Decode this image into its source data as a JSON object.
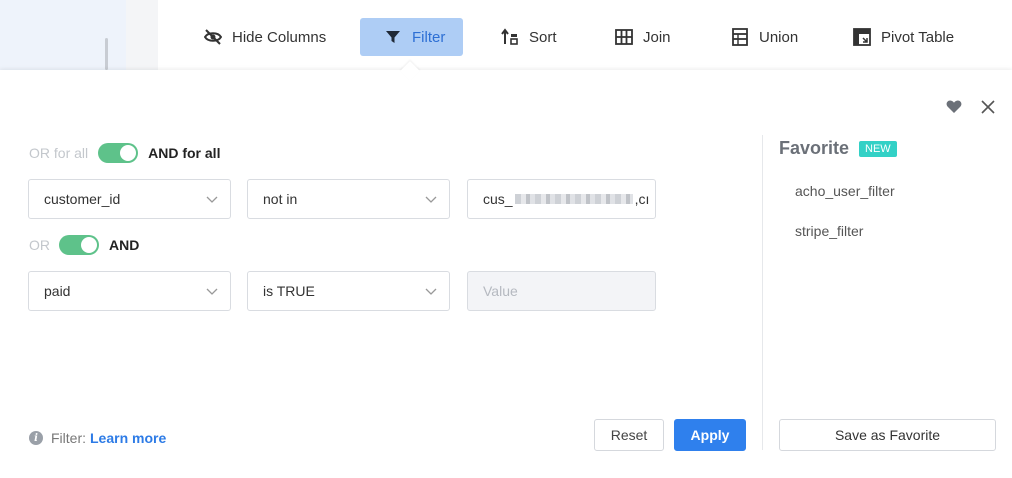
{
  "toolbar": {
    "items": [
      {
        "label": "Hide Columns",
        "icon": "eye-off-icon",
        "active": false
      },
      {
        "label": "Filter",
        "icon": "filter-icon",
        "active": true
      },
      {
        "label": "Sort",
        "icon": "sort-icon",
        "active": false
      },
      {
        "label": "Join",
        "icon": "join-icon",
        "active": false
      },
      {
        "label": "Union",
        "icon": "union-icon",
        "active": false
      },
      {
        "label": "Pivot Table",
        "icon": "pivot-table-icon",
        "active": false
      }
    ]
  },
  "panel": {
    "icons": {
      "favorite": "heart-icon",
      "close": "close-icon"
    },
    "group_logic": {
      "left": "OR for all",
      "right": "AND for all",
      "selected": "AND for all"
    },
    "conditions": [
      {
        "column": "customer_id",
        "operator": "not in",
        "value_prefix": "cus_",
        "value_suffix": ",cı",
        "value_placeholder": ""
      },
      {
        "column": "paid",
        "operator": "is TRUE",
        "value_prefix": "",
        "value_suffix": "",
        "value_placeholder": "Value"
      }
    ],
    "condition_logic": {
      "left": "OR",
      "right": "AND",
      "selected": "AND"
    },
    "help": {
      "prefix": "Filter:",
      "link": "Learn more"
    },
    "buttons": {
      "reset": "Reset",
      "apply": "Apply"
    }
  },
  "favorites": {
    "title": "Favorite",
    "badge": "NEW",
    "items": [
      "acho_user_filter",
      "stripe_filter"
    ],
    "save_button": "Save as Favorite"
  },
  "colors": {
    "accent": "#2f80ed",
    "active_tab_bg": "#aecdf5",
    "toggle_on": "#5ec28a",
    "badge": "#33d1c6"
  }
}
